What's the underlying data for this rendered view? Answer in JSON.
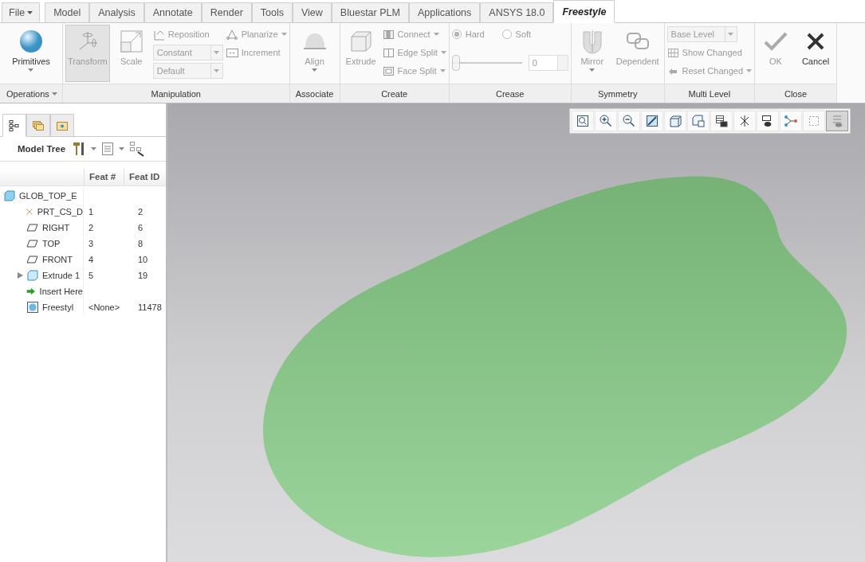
{
  "tabs": [
    {
      "label": "File",
      "kind": "menu",
      "selected": false
    },
    {
      "label": "Model",
      "kind": "tab",
      "selected": false
    },
    {
      "label": "Analysis",
      "kind": "tab",
      "selected": false
    },
    {
      "label": "Annotate",
      "kind": "tab",
      "selected": false
    },
    {
      "label": "Render",
      "kind": "tab",
      "selected": false
    },
    {
      "label": "Tools",
      "kind": "tab",
      "selected": false
    },
    {
      "label": "View",
      "kind": "tab",
      "selected": false
    },
    {
      "label": "Bluestar PLM",
      "kind": "tab",
      "selected": false
    },
    {
      "label": "Applications",
      "kind": "tab",
      "selected": false
    },
    {
      "label": "ANSYS 18.0",
      "kind": "tab",
      "selected": false
    },
    {
      "label": "Freestyle",
      "kind": "tab",
      "selected": true
    }
  ],
  "ribbon": [
    {
      "label": "Operations",
      "dropdown": true,
      "items": [
        {
          "kind": "big",
          "label": "Primitives",
          "dropdown": true,
          "disabled": false,
          "selected": false
        }
      ]
    },
    {
      "label": "Manipulation",
      "dropdown": false,
      "items": [
        {
          "kind": "big",
          "label": "Transform",
          "dropdown": false,
          "disabled": true,
          "selected": true
        },
        {
          "kind": "big",
          "label": "Scale",
          "dropdown": false,
          "disabled": true,
          "selected": false
        },
        {
          "kind": "column",
          "items": [
            {
              "kind": "small",
              "label": "Reposition",
              "dropdown": false,
              "disabled": true
            },
            {
              "kind": "combo",
              "value": "Constant",
              "disabled": true
            },
            {
              "kind": "combo",
              "value": "Default",
              "disabled": true
            }
          ]
        },
        {
          "kind": "column",
          "items": [
            {
              "kind": "small",
              "label": "Planarize",
              "dropdown": true,
              "disabled": true
            },
            {
              "kind": "small",
              "label": "Increment",
              "dropdown": false,
              "disabled": true
            }
          ]
        }
      ]
    },
    {
      "label": "Associate",
      "dropdown": false,
      "items": [
        {
          "kind": "big",
          "label": "Align",
          "dropdown": true,
          "disabled": true,
          "selected": false
        }
      ]
    },
    {
      "label": "Create",
      "dropdown": false,
      "items": [
        {
          "kind": "big",
          "label": "Extrude",
          "dropdown": false,
          "disabled": true,
          "selected": false
        },
        {
          "kind": "column",
          "items": [
            {
              "kind": "small",
              "label": "Connect",
              "dropdown": true,
              "disabled": true
            },
            {
              "kind": "small",
              "label": "Edge Split",
              "dropdown": true,
              "disabled": true
            },
            {
              "kind": "small",
              "label": "Face Split",
              "dropdown": true,
              "disabled": true
            }
          ]
        }
      ]
    },
    {
      "label": "Crease",
      "dropdown": false,
      "items": [
        {
          "kind": "column",
          "items": [
            {
              "kind": "radios",
              "options": [
                {
                  "label": "Hard",
                  "selected": true,
                  "disabled": true
                },
                {
                  "label": "Soft",
                  "selected": false,
                  "disabled": true
                }
              ]
            },
            {
              "kind": "slider",
              "level": 0,
              "value": "0",
              "disabled": true
            }
          ]
        }
      ]
    },
    {
      "label": "Symmetry",
      "dropdown": false,
      "items": [
        {
          "kind": "big",
          "label": "Mirror",
          "dropdown": true,
          "disabled": true,
          "selected": false
        },
        {
          "kind": "big",
          "label": "Dependent",
          "dropdown": false,
          "disabled": true,
          "selected": false
        }
      ]
    },
    {
      "label": "Multi Level",
      "dropdown": false,
      "items": [
        {
          "kind": "column",
          "items": [
            {
              "kind": "combo",
              "value": "Base Level",
              "disabled": true
            },
            {
              "kind": "small",
              "label": "Show Changed",
              "dropdown": false,
              "disabled": true
            },
            {
              "kind": "small",
              "label": "Reset Changed",
              "dropdown": true,
              "disabled": true
            }
          ]
        }
      ]
    },
    {
      "label": "Close",
      "dropdown": false,
      "items": [
        {
          "kind": "big",
          "label": "OK",
          "dropdown": false,
          "disabled": true,
          "selected": false
        },
        {
          "kind": "big",
          "label": "Cancel",
          "dropdown": false,
          "disabled": false,
          "selected": false
        }
      ]
    }
  ],
  "panel_tabs": [
    {
      "selected": true
    },
    {
      "selected": false
    },
    {
      "selected": false
    }
  ],
  "model_tree": {
    "title": "Model Tree",
    "columns": [
      "Feat #",
      "Feat ID"
    ],
    "rows": [
      {
        "name": "GLOB_TOP_E",
        "children": [
          {
            "name": "PRT_CS_D",
            "feat_num": "1",
            "feat_id": "2"
          },
          {
            "name": "RIGHT",
            "feat_num": "2",
            "feat_id": "6"
          },
          {
            "name": "TOP",
            "feat_num": "3",
            "feat_id": "8"
          },
          {
            "name": "FRONT",
            "feat_num": "4",
            "feat_id": "10"
          },
          {
            "name": "Extrude 1",
            "feat_num": "5",
            "feat_id": "19",
            "expanded": false
          },
          {
            "name": "Insert Here"
          },
          {
            "name": "Freestyl",
            "feat_num": "<None>",
            "feat_id": "11478"
          }
        ]
      }
    ]
  },
  "view_toolbar": [
    {
      "selected": false
    },
    {
      "selected": false
    },
    {
      "selected": false
    },
    {
      "selected": false
    },
    {
      "selected": false
    },
    {
      "selected": false
    },
    {
      "selected": false
    },
    {
      "selected": false
    },
    {
      "selected": false
    },
    {
      "selected": false
    },
    {
      "selected": false
    },
    {
      "selected": true
    }
  ]
}
